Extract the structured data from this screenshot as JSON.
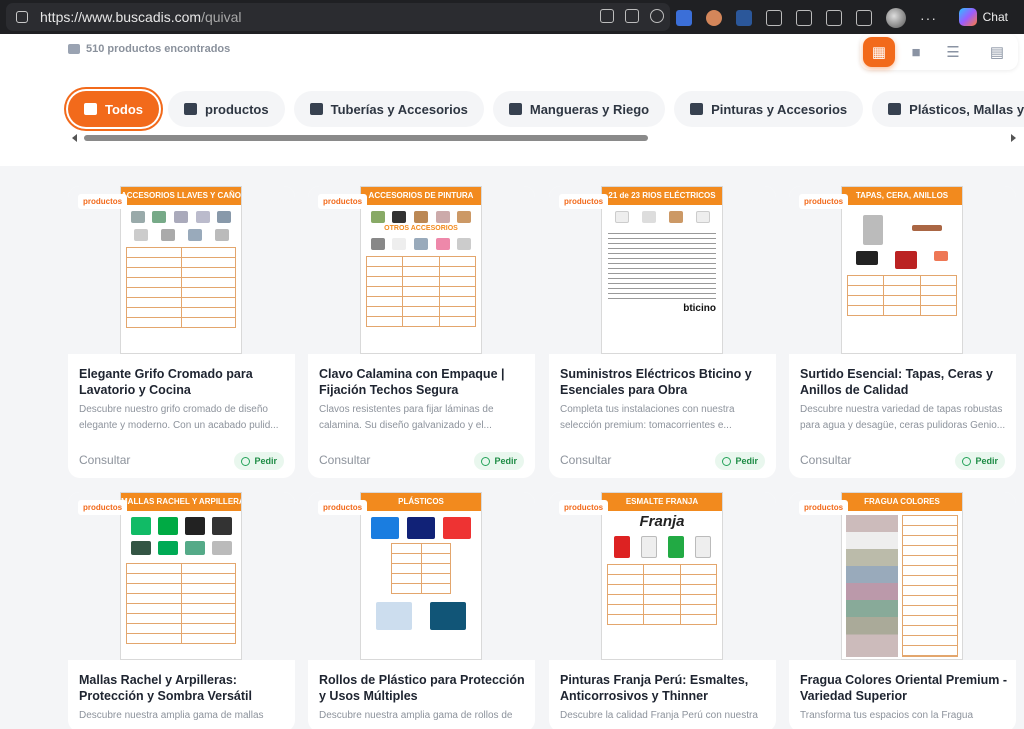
{
  "browser": {
    "url_host": "https://www.buscadis.com",
    "url_path": "/quival",
    "chat_label": "Chat",
    "more_label": "···"
  },
  "header": {
    "results_count": "510 productos encontrados"
  },
  "categories": [
    {
      "label": "Todos",
      "active": true
    },
    {
      "label": "productos"
    },
    {
      "label": "Tuberías y Accesorios"
    },
    {
      "label": "Mangueras y Riego"
    },
    {
      "label": "Pinturas y Accesorios"
    },
    {
      "label": "Plásticos, Mallas y Arpillera"
    }
  ],
  "products": [
    {
      "badge": "productos",
      "thumb_title": "ACCESORIOS LLAVES Y CAÑOS",
      "title": "Elegante Grifo Cromado para Lavatorio y Cocina",
      "desc": "Descubre nuestro grifo cromado de diseño elegante y moderno. Con un acabado pulid...",
      "consult": "Consultar",
      "order": "Pedir"
    },
    {
      "badge": "productos",
      "thumb_title": "ACCESORIOS DE PINTURA",
      "thumb_sub": "OTROS ACCESORIOS",
      "title": "Clavo Calamina con Empaque | Fijación Techos Segura",
      "desc": "Clavos resistentes para fijar láminas de calamina. Su diseño galvanizado y el...",
      "consult": "Consultar",
      "order": "Pedir"
    },
    {
      "badge": "productos",
      "thumb_title": "21 de 23  RIOS ELÉCTRICOS",
      "title": "Suministros Eléctricos Bticino y Esenciales para Obra",
      "desc": "Completa tus instalaciones con nuestra selección premium: tomacorrientes e...",
      "consult": "Consultar",
      "order": "Pedir"
    },
    {
      "badge": "productos",
      "thumb_title": "TAPAS, CERA, ANILLOS",
      "title": "Surtido Esencial: Tapas, Ceras y Anillos de Calidad",
      "desc": "Descubre nuestra variedad de tapas robustas para agua y desagüe, ceras pulidoras Genio...",
      "consult": "Consultar",
      "order": "Pedir"
    },
    {
      "badge": "productos",
      "thumb_title": "MALLAS RACHEL Y ARPILLERAS",
      "title": "Mallas Rachel y Arpilleras: Protección y Sombra Versátil",
      "desc": "Descubre nuestra amplia gama de mallas"
    },
    {
      "badge": "productos",
      "thumb_title": "PLÁSTICOS",
      "title": "Rollos de Plástico para Protección y Usos Múltiples",
      "desc": "Descubre nuestra amplia gama de rollos de"
    },
    {
      "badge": "productos",
      "thumb_title": "ESMALTE FRANJA",
      "title": "Pinturas Franja Perú: Esmaltes, Anticorrosivos y Thinner",
      "desc": "Descubre la calidad Franja Perú con nuestra"
    },
    {
      "badge": "productos",
      "thumb_title": "FRAGUA COLORES",
      "title": "Fragua Colores Oriental Premium - Variedad Superior",
      "desc": "Transforma tus espacios con la Fragua"
    }
  ],
  "colors": {
    "accent": "#f26a1b",
    "whatsapp": "#25a35a"
  }
}
